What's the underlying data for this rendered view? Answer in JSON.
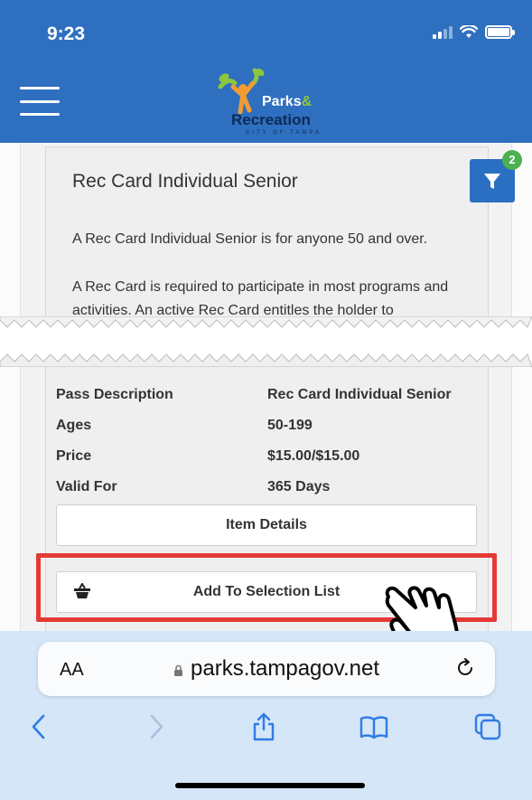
{
  "status_bar": {
    "time": "9:23"
  },
  "header": {
    "logo_parks": "Parks",
    "logo_amp": "&",
    "logo_recreation": "Recreation",
    "logo_city": "CITY OF TAMPA"
  },
  "filter": {
    "badge_count": "2"
  },
  "card": {
    "title": "Rec Card Individual Senior",
    "paragraph_1": "A Rec Card Individual Senior is for anyone 50 and over.",
    "paragraph_2": "A Rec Card is required to participate in most programs and activities. An active Rec Card entitles the holder to"
  },
  "details": [
    {
      "label": "Pass Description",
      "value": "Rec Card Individual Senior"
    },
    {
      "label": "Ages",
      "value": "50-199"
    },
    {
      "label": "Price",
      "value": "$15.00/$15.00"
    },
    {
      "label": "Valid For",
      "value": "365 Days"
    }
  ],
  "buttons": {
    "item_details": "Item Details",
    "add_to_selection": "Add To Selection List"
  },
  "safari": {
    "text_size": "AA",
    "url": "parks.tampagov.net"
  },
  "colors": {
    "brand_blue": "#2f6fc0",
    "highlight_red": "#e53935",
    "badge_green": "#4caf50"
  }
}
